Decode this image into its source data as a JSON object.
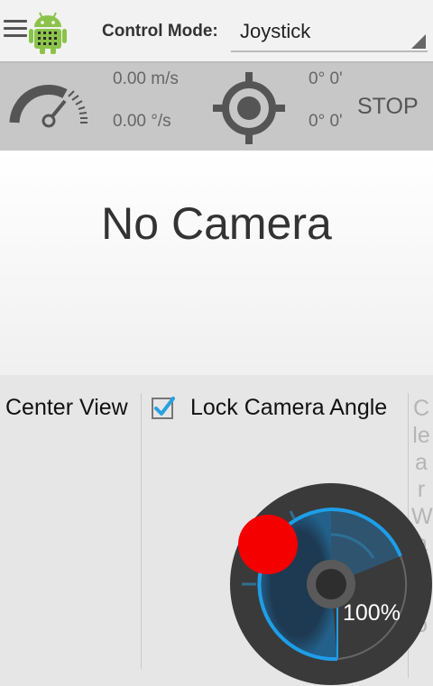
{
  "header": {
    "menu_icon": "hamburger-menu-icon",
    "app_icon": "android-robot-icon",
    "control_mode_label": "Control Mode:",
    "control_mode_value": "Joystick"
  },
  "status": {
    "speed_icon": "speedometer-icon",
    "linear_speed": "0.00 m/s",
    "angular_speed": "0.00 °/s",
    "gps_icon": "crosshair-target-icon",
    "lat": "0° 0'",
    "lon": "0° 0'",
    "stop_label": "STOP"
  },
  "camera": {
    "message": "No Camera"
  },
  "controls": {
    "center_view_label": "Center View",
    "lock_camera_checked": true,
    "lock_camera_label": "Lock Camera Angle",
    "clear_waypoints_label": "Clear Waypo"
  },
  "joystick": {
    "percent_label": "100%",
    "accent_color": "#1e9ee8",
    "knob_color": "#f50000"
  }
}
